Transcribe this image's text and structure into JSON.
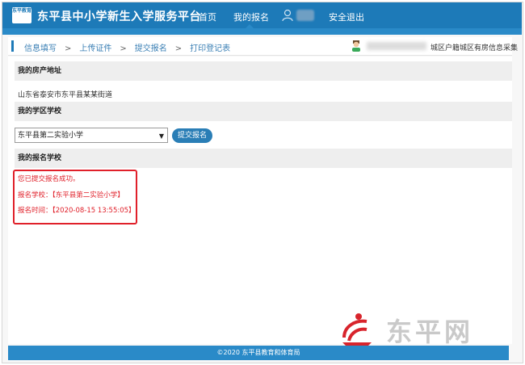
{
  "header": {
    "logo_text": "东平教育",
    "title": "东平县中小学新生入学服务平台",
    "nav": {
      "home": "首页",
      "my_registration": "我的报名",
      "logout": "安全退出"
    }
  },
  "breadcrumb": {
    "step1": "信息填写",
    "step2": "上传证件",
    "step3": "提交报名",
    "step4": "打印登记表",
    "separator": ">"
  },
  "user": {
    "category": "城区户籍城区有房信息采集"
  },
  "sections": {
    "property_address": {
      "heading": "我的房产地址",
      "value": "山东省泰安市东平县某某街道"
    },
    "district_school": {
      "heading": "我的学区学校",
      "selected_school": "东平县第二实验小学",
      "submit_label": "提交报名"
    },
    "registered_school": {
      "heading": "我的报名学校",
      "success_message": "您已提交报名成功。",
      "school_line": "报名学校：【东平县第二实验小学】",
      "time_line": "报名时间：【2020-08-15 13:55:05】"
    }
  },
  "watermark": {
    "text": "东平网"
  },
  "footer": {
    "text": "©2020  东平县教育和体育局"
  },
  "colors": {
    "primary": "#1d7ab8",
    "accent_bar": "#2a8ac8",
    "alert": "#e0202a",
    "button": "#2a7eb6"
  }
}
